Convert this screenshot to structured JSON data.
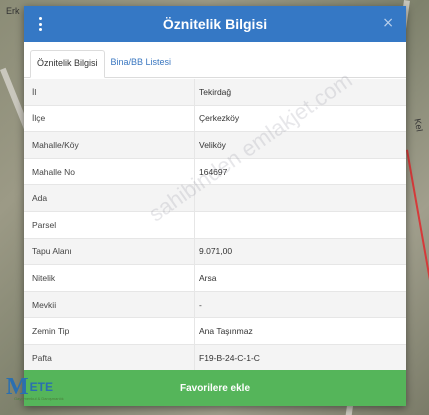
{
  "header": {
    "title": "Öznitelik Bilgisi",
    "close_symbol": "×"
  },
  "tabs": [
    {
      "label": "Öznitelik Bilgisi",
      "active": true
    },
    {
      "label": "Bina/BB Listesi",
      "active": false
    }
  ],
  "attributes": [
    {
      "key": "İl",
      "value": "Tekirdağ"
    },
    {
      "key": "İlçe",
      "value": "Çerkezköy"
    },
    {
      "key": "Mahalle/Köy",
      "value": "Veliköy"
    },
    {
      "key": "Mahalle No",
      "value": "164697"
    },
    {
      "key": "Ada",
      "value": ""
    },
    {
      "key": "Parsel",
      "value": ""
    },
    {
      "key": "Tapu Alanı",
      "value": "9.071,00"
    },
    {
      "key": "Nitelik",
      "value": "Arsa"
    },
    {
      "key": "Mevkii",
      "value": "-"
    },
    {
      "key": "Zemin Tip",
      "value": "Ana Taşınmaz"
    },
    {
      "key": "Pafta",
      "value": "F19-B-24-C-1-C"
    }
  ],
  "footer": {
    "favorite_label": "Favorilere ekle"
  },
  "watermark": "sahibinden emlakjet.com",
  "logo": {
    "letters_m": "M",
    "letters_rest": "ETE",
    "subtitle": "Gayrimenkul & Danışmanlık"
  },
  "map": {
    "label_left": "Erk",
    "label_right": "Kel"
  },
  "colors": {
    "header": "#3578c5",
    "favorite_button": "#55b55a",
    "tab_link": "#3a77c0",
    "parcel_border": "#d63a3a"
  },
  "icons": [
    "menu-icon",
    "close-icon",
    "logo-icon"
  ]
}
